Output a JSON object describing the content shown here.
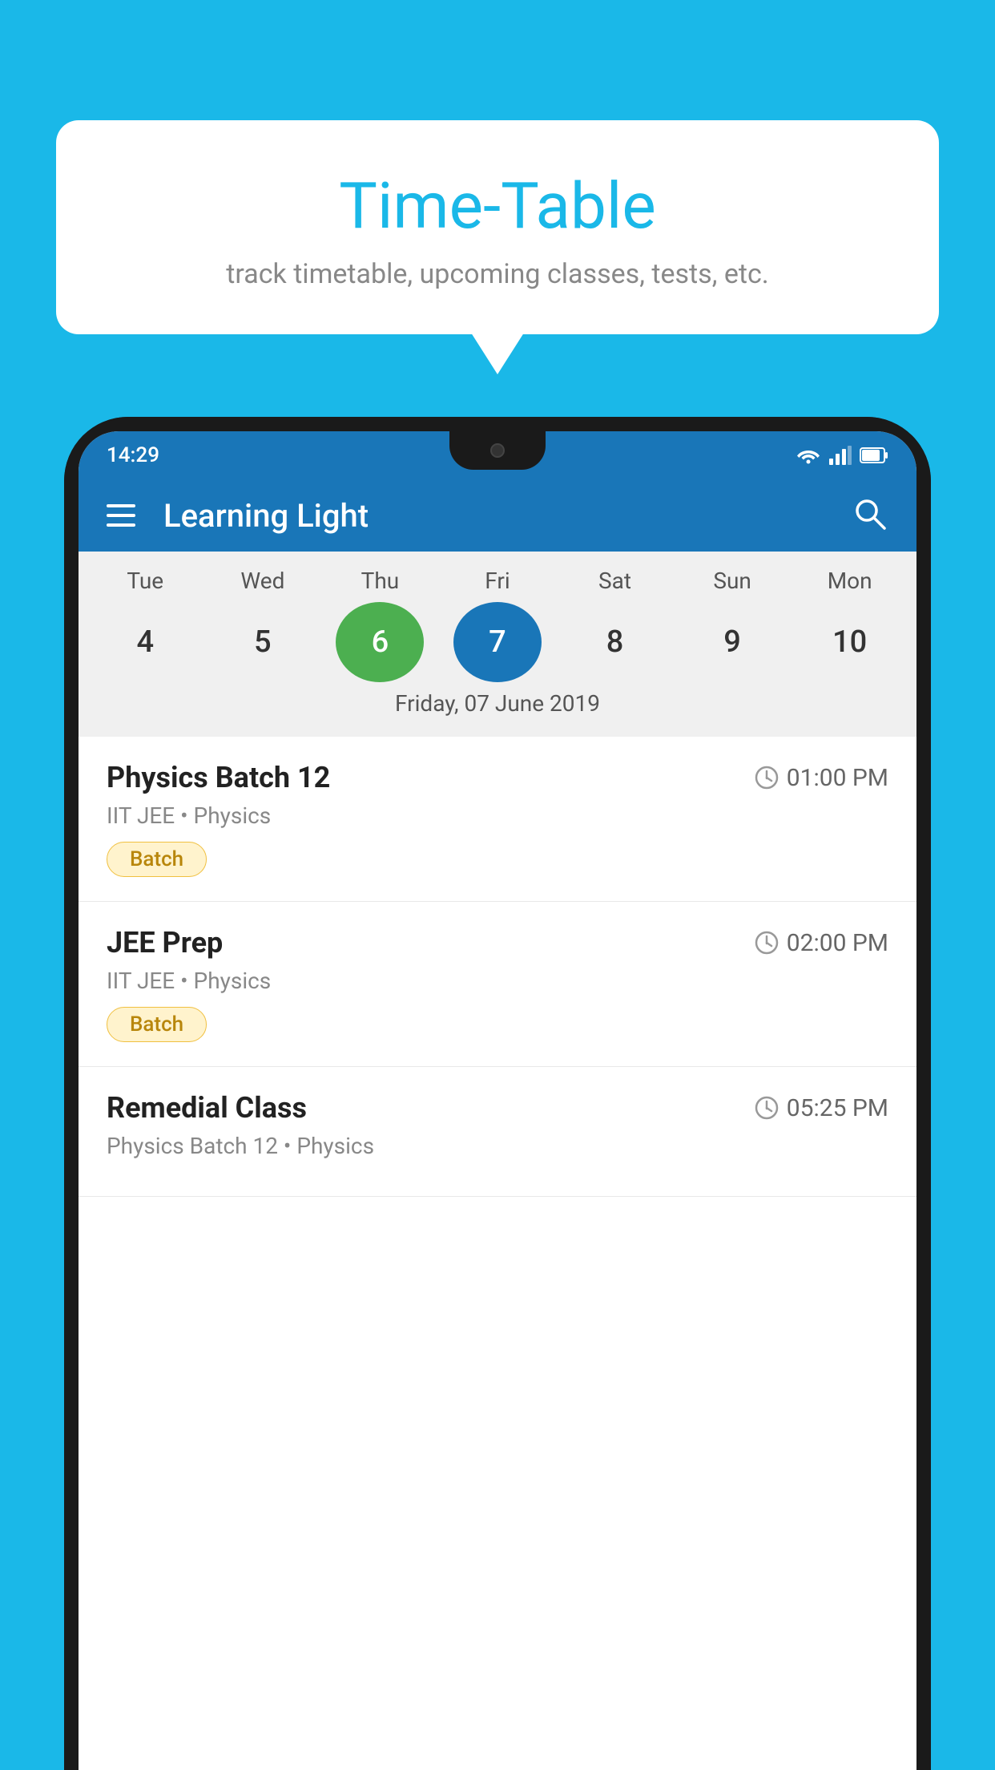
{
  "background_color": "#1ab8e8",
  "bubble": {
    "title": "Time-Table",
    "subtitle": "track timetable, upcoming classes, tests, etc."
  },
  "phone": {
    "status_bar": {
      "time": "14:29",
      "wifi": "▾",
      "signal": "▲",
      "battery": "▮"
    },
    "app_header": {
      "title": "Learning Light",
      "search_label": "search"
    },
    "calendar": {
      "days": [
        "Tue",
        "Wed",
        "Thu",
        "Fri",
        "Sat",
        "Sun",
        "Mon"
      ],
      "dates": [
        "4",
        "5",
        "6",
        "7",
        "8",
        "9",
        "10"
      ],
      "today_index": 2,
      "selected_index": 3,
      "selected_date_label": "Friday, 07 June 2019"
    },
    "schedule": [
      {
        "title": "Physics Batch 12",
        "time": "01:00 PM",
        "subtitle": "IIT JEE • Physics",
        "badge": "Batch"
      },
      {
        "title": "JEE Prep",
        "time": "02:00 PM",
        "subtitle": "IIT JEE • Physics",
        "badge": "Batch"
      },
      {
        "title": "Remedial Class",
        "time": "05:25 PM",
        "subtitle": "Physics Batch 12 • Physics",
        "badge": ""
      }
    ]
  }
}
